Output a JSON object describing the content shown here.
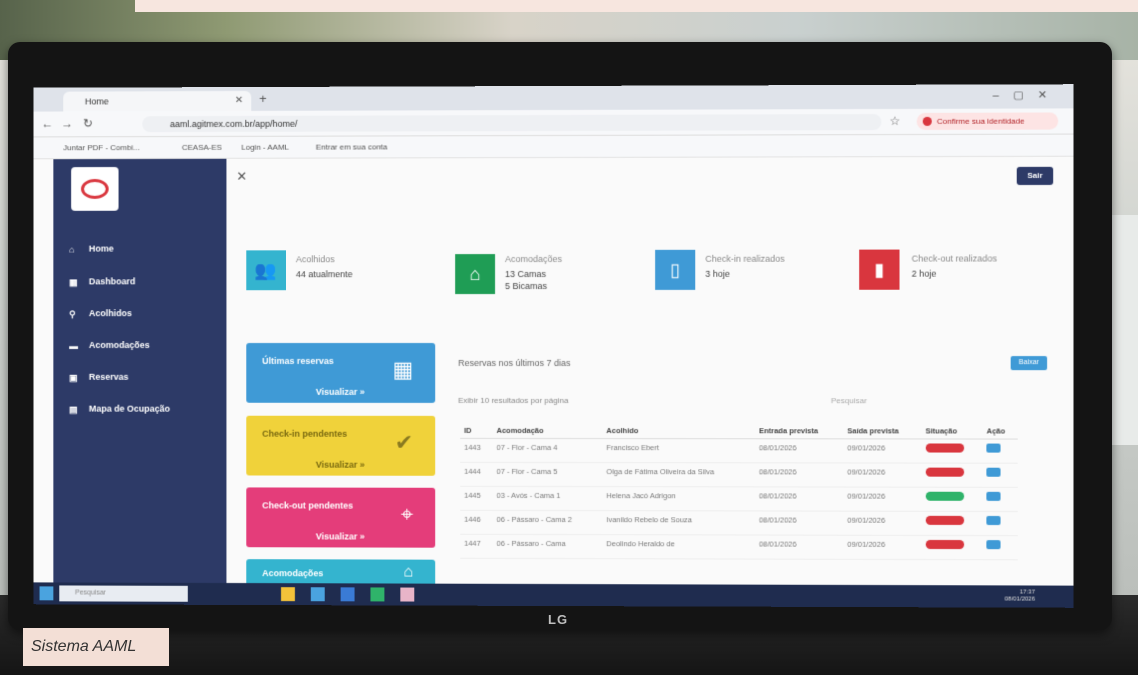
{
  "browser": {
    "tab_title": "Home",
    "url": "aaml.agitmex.com.br/app/home/",
    "identity_button": "Confirme sua identidade",
    "bookmarks": [
      "Juntar PDF - Combi...",
      "CEASA-ES",
      "Login - AAML",
      "Entrar em sua conta"
    ]
  },
  "sidebar": {
    "items": [
      {
        "label": "Home",
        "icon": "home-icon"
      },
      {
        "label": "Dashboard",
        "icon": "dashboard-icon"
      },
      {
        "label": "Acolhidos",
        "icon": "user-icon"
      },
      {
        "label": "Acomodações",
        "icon": "bed-icon"
      },
      {
        "label": "Reservas",
        "icon": "calendar-icon"
      },
      {
        "label": "Mapa de Ocupação",
        "icon": "map-icon"
      }
    ]
  },
  "header": {
    "logout_label": "Sair"
  },
  "stats": [
    {
      "title": "Acolhidos",
      "value": "44 atualmente",
      "color": "#34b4cf",
      "icon": "people-icon"
    },
    {
      "title": "Acomodações",
      "value": "13 Camas",
      "value2": "5 Bicamas",
      "color": "#1f9d55",
      "icon": "house-icon"
    },
    {
      "title": "Check-in realizados",
      "value": "3 hoje",
      "color": "#3f9ad6",
      "icon": "door-icon"
    },
    {
      "title": "Check-out realizados",
      "value": "2 hoje",
      "color": "#d9363e",
      "icon": "door-exit-icon"
    }
  ],
  "cards": [
    {
      "title": "Últimas reservas",
      "link": "Visualizar »",
      "color": "#3f9ad6",
      "icon": "calendar-icon"
    },
    {
      "title": "Check-in pendentes",
      "link": "Visualizar »",
      "color": "#f0d23a",
      "icon": "check-icon"
    },
    {
      "title": "Check-out pendentes",
      "link": "Visualizar »",
      "color": "#e43d7a",
      "icon": "pin-icon"
    },
    {
      "title": "Acomodações",
      "color": "#34b4cf",
      "icon": "house-icon"
    }
  ],
  "reservations": {
    "title": "Reservas nos últimos 7 dias",
    "download_label": "Baixar",
    "show_prefix": "Exibir",
    "per_page": "10",
    "show_suffix": "resultados por página",
    "search_label": "Pesquisar",
    "columns": [
      "ID",
      "Acomodação",
      "Acolhido",
      "Entrada prevista",
      "Saída prevista",
      "Situação",
      "Ação"
    ],
    "rows": [
      {
        "id": "1443",
        "acomodacao": "07 - Flor - Cama 4",
        "acolhido": "Francisco Ebert",
        "entrada": "08/01/2026",
        "saida": "09/01/2026",
        "status": "red"
      },
      {
        "id": "1444",
        "acomodacao": "07 - Flor - Cama 5",
        "acolhido": "Olga de Fátima Oliveira da Silva",
        "entrada": "08/01/2026",
        "saida": "09/01/2026",
        "status": "red"
      },
      {
        "id": "1445",
        "acomodacao": "03 - Avós - Cama 1",
        "acolhido": "Helena Jacó Adrigon",
        "entrada": "08/01/2026",
        "saida": "09/01/2026",
        "status": "green"
      },
      {
        "id": "1446",
        "acomodacao": "06 - Pássaro - Cama 2",
        "acolhido": "Ivanildo Rebelo de Souza",
        "entrada": "08/01/2026",
        "saida": "09/01/2026",
        "status": "red"
      },
      {
        "id": "1447",
        "acomodacao": "06 - Pássaro - Cama",
        "acolhido": "Deolindo Heraldo de",
        "entrada": "08/01/2026",
        "saida": "09/01/2026",
        "status": "red"
      }
    ]
  },
  "taskbar": {
    "search_placeholder": "Pesquisar",
    "time": "17:37",
    "date": "08/01/2026"
  },
  "monitor_brand": "LG",
  "caption": "Sistema AAML"
}
